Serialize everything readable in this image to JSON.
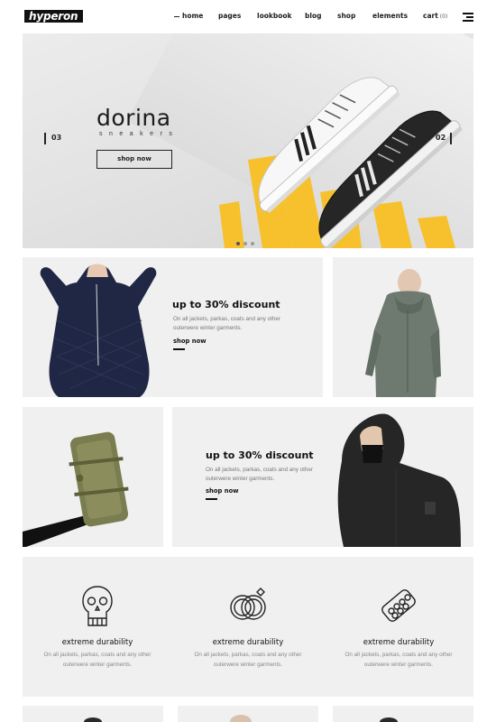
{
  "header": {
    "logo": "hyperon",
    "nav": [
      "home",
      "pages",
      "lookbook",
      "blog",
      "shop",
      "elements",
      "cart"
    ],
    "cart_count": "(0)"
  },
  "hero": {
    "title": "dorina",
    "subtitle": "sneakers",
    "button": "shop now",
    "slide_prev": "03",
    "slide_next": "02",
    "accent_color": "#f6c12c"
  },
  "promos": [
    {
      "title": "up to 30% discount",
      "text": [
        "On all jackets, parkas, coats and any other",
        "outerwere winter garments."
      ],
      "link": "shop now"
    },
    {
      "title": "up to 30% discount",
      "text": [
        "On all jackets, parkas, coats and any other",
        "outerwere winter garments."
      ],
      "link": "shop now"
    }
  ],
  "features": [
    {
      "icon": "skull-icon",
      "title": "extreme durability",
      "text": [
        "On all jackets, parkas, coats and any other",
        "outerwere winter garments."
      ]
    },
    {
      "icon": "rings-icon",
      "title": "extreme durability",
      "text": [
        "On all jackets, parkas, coats and any other",
        "outerwere winter garments."
      ]
    },
    {
      "icon": "pills-icon",
      "title": "extreme durability",
      "text": [
        "On all jackets, parkas, coats and any other",
        "outerwere winter garments."
      ]
    }
  ]
}
